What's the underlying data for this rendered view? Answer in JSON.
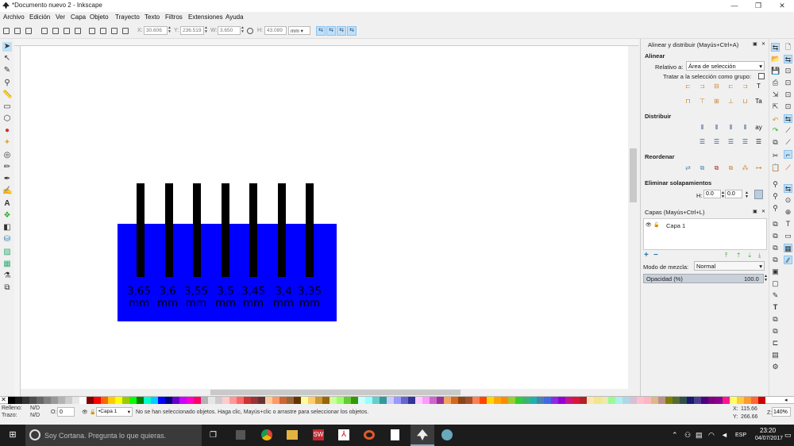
{
  "window": {
    "title": "*Documento nuevo 2 - Inkscape",
    "minimize": "—",
    "restore": "❐",
    "close": "✕"
  },
  "menu": [
    "Archivo",
    "Edición",
    "Ver",
    "Capa",
    "Objeto",
    "Trayecto",
    "Texto",
    "Filtros",
    "Extensiones",
    "Ayuda"
  ],
  "toolbar": {
    "x_label": "X:",
    "x_value": "30.606",
    "y_label": "Y:",
    "y_value": "236.519",
    "w_label": "W:",
    "w_value": "3.650",
    "h_label": "H:",
    "h_value": "43.089",
    "unit": "mm"
  },
  "canvas": {
    "rect_color": "#0000ff",
    "bar_color": "#000000",
    "labels": [
      {
        "num": "3,65",
        "unit": "mm"
      },
      {
        "num": "3,6",
        "unit": "mm"
      },
      {
        "num": "3,55",
        "unit": "mm"
      },
      {
        "num": "3,5",
        "unit": "mm"
      },
      {
        "num": "3,45",
        "unit": "mm"
      },
      {
        "num": "3,4",
        "unit": "mm"
      },
      {
        "num": "3,35",
        "unit": "mm"
      }
    ]
  },
  "align_panel": {
    "title": "Alinear y distribuir (Mayús+Ctrl+A)",
    "section_align": "Alinear",
    "relative_label": "Relativo a:",
    "relative_value": "Área de selección",
    "treat_group_label": "Tratar a la selección como grupo:",
    "section_distribute": "Distribuir",
    "section_reorder": "Reordenar",
    "section_overlap": "Eliminar solapamientos",
    "h_label": "H:",
    "h_value": "0.0",
    "v_label": "V:",
    "v_value": "0.0"
  },
  "layers_panel": {
    "title": "Capas (Mayús+Ctrl+L)",
    "layer_name": "Capa 1",
    "blend_label": "Modo de mezcla:",
    "blend_value": "Normal",
    "opacity_label": "Opacidad (%)",
    "opacity_value": "100.0",
    "add": "+",
    "remove": "−"
  },
  "status": {
    "fill_label": "Relleno:",
    "fill_value": "N/D",
    "stroke_label": "Trazo:",
    "stroke_value": "N/D",
    "o_label": "O:",
    "o_value": "0",
    "layer_value": "•Capa 1",
    "message": "No se han seleccionado objetos. Haga clic, Mayús+clic o arrastre para seleccionar los objetos.",
    "x_label": "X:",
    "x_value": "115.66",
    "y_label": "Y:",
    "y_value": "266.66",
    "z_label": "Z:",
    "z_value": "140%"
  },
  "taskbar": {
    "search_placeholder": "Soy Cortana. Pregunta lo que quieras.",
    "lang": "ESP",
    "time": "23:20",
    "date": "04/07/2017"
  },
  "palette_colors": [
    "#000000",
    "#1a1a1a",
    "#333333",
    "#4d4d4d",
    "#666666",
    "#808080",
    "#999999",
    "#b3b3b3",
    "#cccccc",
    "#e6e6e6",
    "#ffffff",
    "#800000",
    "#ff0000",
    "#ff6600",
    "#ffcc00",
    "#ffff00",
    "#99cc00",
    "#00ff00",
    "#008000",
    "#00ffcc",
    "#00ccff",
    "#0000ff",
    "#000080",
    "#6600cc",
    "#cc00ff",
    "#ff00cc",
    "#ff0066",
    "#b3b3b3",
    "#e6e6e6",
    "#cccccc",
    "#ffcccc",
    "#ff9999",
    "#ff6666",
    "#cc3333",
    "#993333",
    "#663333",
    "#ffcc99",
    "#ff9966",
    "#cc6633",
    "#996633",
    "#663300",
    "#ffff99",
    "#ffcc66",
    "#cc9933",
    "#996600",
    "#ccff99",
    "#99ff66",
    "#66cc33",
    "#339900",
    "#ccffff",
    "#99ffff",
    "#66cccc",
    "#339999",
    "#ccccff",
    "#9999ff",
    "#6666cc",
    "#333399",
    "#ffccff",
    "#ff99ff",
    "#cc66cc",
    "#993399",
    "#f4a460",
    "#d2691e",
    "#8b4513",
    "#a0522d",
    "#ff7f50",
    "#ff4500",
    "#ffd700",
    "#ffa500",
    "#ff8c00",
    "#9acd32",
    "#32cd32",
    "#3cb371",
    "#20b2aa",
    "#4682b4",
    "#4169e1",
    "#8a2be2",
    "#9400d3",
    "#c71585",
    "#dc143c",
    "#b22222",
    "#ffe4b5",
    "#f0e68c",
    "#eee8aa",
    "#98fb98",
    "#afeeee",
    "#add8e6",
    "#d8bfd8",
    "#ffc0cb",
    "#ffb6c1",
    "#deb887",
    "#bc8f8f",
    "#808000",
    "#556b2f",
    "#2f4f4f",
    "#191970",
    "#483d8b",
    "#4b0082",
    "#800080",
    "#8b008b",
    "#ff1493",
    "#ffff66",
    "#ffcc33",
    "#ff9933",
    "#ff6633",
    "#cc0000"
  ]
}
